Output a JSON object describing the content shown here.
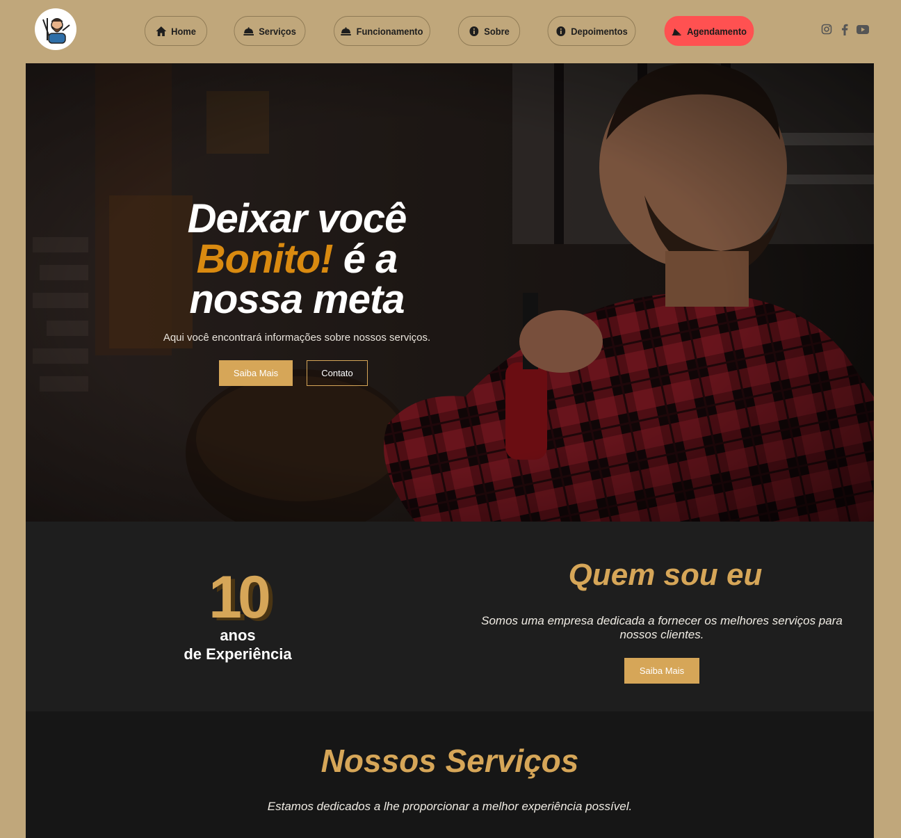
{
  "nav": {
    "items": [
      {
        "label": "Home",
        "icon": "home-icon"
      },
      {
        "label": "Serviços",
        "icon": "cloche-icon"
      },
      {
        "label": "Funcionamento",
        "icon": "cloche-icon"
      },
      {
        "label": "Sobre",
        "icon": "info-icon"
      },
      {
        "label": "Depoimentos",
        "icon": "info-icon"
      },
      {
        "label": "Agendamento",
        "icon": "bell-icon"
      }
    ],
    "cta_color": "#ff5151"
  },
  "social": [
    "instagram-icon",
    "facebook-icon",
    "youtube-icon"
  ],
  "hero": {
    "title_line1": "Deixar você",
    "title_accent": "Bonito!",
    "title_after_accent": " é a",
    "title_line3": "nossa meta",
    "subtitle": "Aqui você encontrará informações sobre nossos serviços.",
    "primary_button": "Saiba Mais",
    "secondary_button": "Contato"
  },
  "about": {
    "years": "10",
    "years_label1": "anos",
    "years_label2": "de Experiência",
    "title": "Quem sou eu",
    "text": "Somos uma empresa dedicada a fornecer os melhores serviços para nossos clientes.",
    "button": "Saiba Mais"
  },
  "services": {
    "title": "Nossos Serviços",
    "text": "Estamos dedicados a lhe proporcionar a melhor experiência possível."
  },
  "colors": {
    "background": "#c0a77b",
    "gold": "#d6a658",
    "accent_orange": "#d98a10",
    "dark": "#1e1e1e"
  }
}
